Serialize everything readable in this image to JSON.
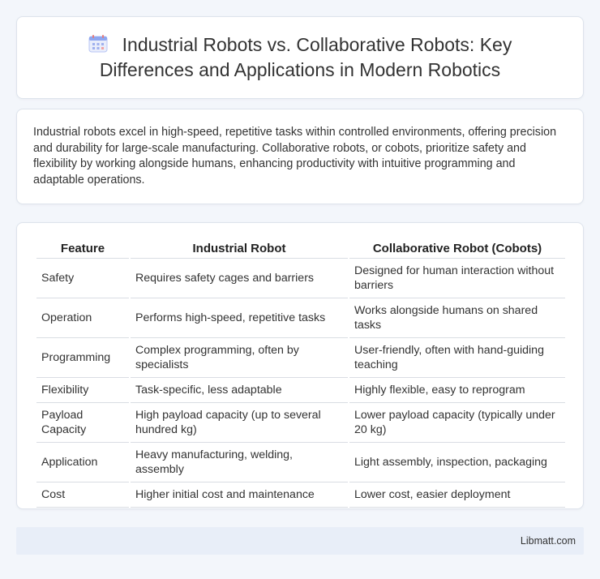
{
  "header": {
    "icon": "calendar-icon",
    "title": "Industrial Robots vs. Collaborative Robots: Key Differences and Applications in Modern Robotics"
  },
  "summary": {
    "text": "Industrial robots excel in high-speed, repetitive tasks within controlled environments, offering precision and durability for large-scale manufacturing. Collaborative robots, or cobots, prioritize safety and flexibility by working alongside humans, enhancing productivity with intuitive programming and adaptable operations."
  },
  "table": {
    "headers": [
      "Feature",
      "Industrial Robot",
      "Collaborative Robot (Cobots)"
    ],
    "rows": [
      [
        "Safety",
        "Requires safety cages and barriers",
        "Designed for human interaction without barriers"
      ],
      [
        "Operation",
        "Performs high-speed, repetitive tasks",
        "Works alongside humans on shared tasks"
      ],
      [
        "Programming",
        "Complex programming, often by specialists",
        "User-friendly, often with hand-guiding teaching"
      ],
      [
        "Flexibility",
        "Task-specific, less adaptable",
        "Highly flexible, easy to reprogram"
      ],
      [
        "Payload Capacity",
        "High payload capacity (up to several hundred kg)",
        "Lower payload capacity (typically under 20 kg)"
      ],
      [
        "Application",
        "Heavy manufacturing, welding, assembly",
        "Light assembly, inspection, packaging"
      ],
      [
        "Cost",
        "Higher initial cost and maintenance",
        "Lower cost, easier deployment"
      ]
    ]
  },
  "footer": {
    "brand": "Libmatt.com"
  },
  "colors": {
    "page_background": "#f3f6fb",
    "card_background": "#ffffff",
    "footer_background": "#e8eef8",
    "icon_accent": "#8ea6f0"
  }
}
